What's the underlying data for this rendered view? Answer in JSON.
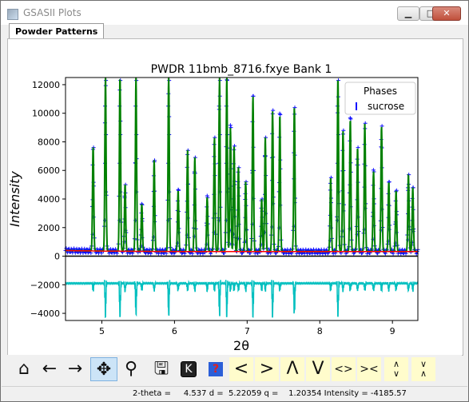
{
  "window": {
    "title": "GSASII Plots"
  },
  "tabs": [
    {
      "label": "Powder Patterns"
    }
  ],
  "plot": {
    "title": "PWDR 11bmb_8716.fxye Bank 1",
    "xlabel": "2θ",
    "ylabel": "Intensity",
    "legend_title": "Phases",
    "legend_entry": "sucrose"
  },
  "toolbar": {
    "home_icon": "home-icon",
    "back_icon": "back-arrow-icon",
    "forward_icon": "forward-arrow-icon",
    "pan_icon": "pan-icon",
    "zoom_icon": "zoom-icon",
    "save_icon": "save-icon",
    "key_icon": "key-press-icon",
    "help_icon": "help-icon",
    "labels": [
      "<",
      ">",
      "Λ",
      "V",
      "<>",
      "><"
    ]
  },
  "status": {
    "text": "2-theta =     4.537 d =  5.22059 q =    1.20354 Intensity = -4185.57"
  },
  "colors": {
    "observed": "#1010ff",
    "calculated": "#008000",
    "background": "#ff0000",
    "difference": "#00bfbf",
    "reflections": "#000000"
  },
  "chart_data": {
    "type": "line",
    "title": "PWDR 11bmb_8716.fxye Bank 1",
    "xlabel": "2θ",
    "ylabel": "Intensity",
    "xlim": [
      4.5,
      9.35
    ],
    "ylim": [
      -4500,
      12500
    ],
    "xticks": [
      5,
      6,
      7,
      8,
      9
    ],
    "yticks": [
      -4000,
      -2000,
      0,
      2000,
      4000,
      6000,
      8000,
      10000,
      12000
    ],
    "legend": {
      "title": "Phases",
      "entries": [
        "sucrose"
      ],
      "position": "top-right"
    },
    "series": [
      {
        "name": "observed",
        "style": "+ markers"
      },
      {
        "name": "calculated",
        "style": "line"
      },
      {
        "name": "background",
        "style": "line",
        "approx_value": 300
      },
      {
        "name": "difference",
        "style": "line",
        "offset": -1900
      }
    ],
    "peaks": [
      {
        "x": 4.88,
        "y": 7600
      },
      {
        "x": 5.05,
        "y": 12500
      },
      {
        "x": 5.25,
        "y": 12500
      },
      {
        "x": 5.32,
        "y": 5000
      },
      {
        "x": 5.47,
        "y": 12500
      },
      {
        "x": 5.55,
        "y": 3600
      },
      {
        "x": 5.72,
        "y": 6700
      },
      {
        "x": 5.92,
        "y": 12500
      },
      {
        "x": 6.05,
        "y": 4600
      },
      {
        "x": 6.18,
        "y": 7400
      },
      {
        "x": 6.28,
        "y": 6900
      },
      {
        "x": 6.45,
        "y": 4100
      },
      {
        "x": 6.55,
        "y": 8300
      },
      {
        "x": 6.62,
        "y": 12500
      },
      {
        "x": 6.72,
        "y": 12500
      },
      {
        "x": 6.77,
        "y": 9000
      },
      {
        "x": 6.82,
        "y": 7700
      },
      {
        "x": 6.88,
        "y": 6200
      },
      {
        "x": 6.98,
        "y": 5200
      },
      {
        "x": 7.08,
        "y": 11200
      },
      {
        "x": 7.2,
        "y": 4000
      },
      {
        "x": 7.25,
        "y": 8300
      },
      {
        "x": 7.35,
        "y": 10200
      },
      {
        "x": 7.45,
        "y": 9900
      },
      {
        "x": 7.65,
        "y": 10400
      },
      {
        "x": 8.15,
        "y": 5500
      },
      {
        "x": 8.25,
        "y": 12500
      },
      {
        "x": 8.32,
        "y": 8800
      },
      {
        "x": 8.42,
        "y": 9600
      },
      {
        "x": 8.52,
        "y": 7600
      },
      {
        "x": 8.62,
        "y": 9300
      },
      {
        "x": 8.74,
        "y": 5900
      },
      {
        "x": 8.85,
        "y": 9100
      },
      {
        "x": 8.95,
        "y": 5200
      },
      {
        "x": 9.05,
        "y": 4600
      },
      {
        "x": 9.22,
        "y": 5700
      },
      {
        "x": 9.28,
        "y": 4800
      }
    ]
  }
}
